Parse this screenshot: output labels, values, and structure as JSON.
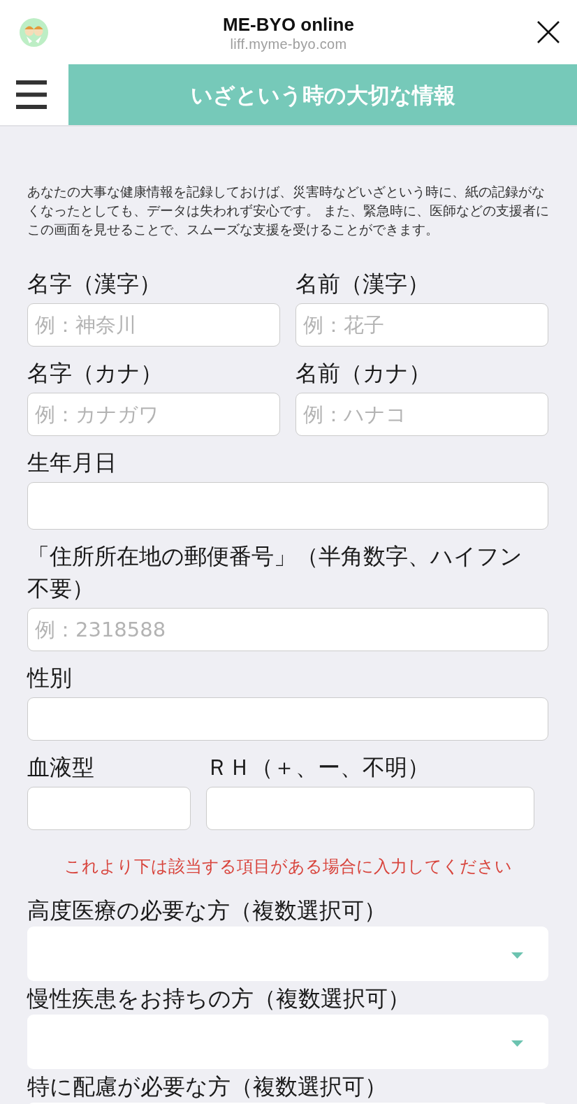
{
  "app_bar": {
    "title": "ME-BYO online",
    "url": "liff.myme-byo.com"
  },
  "page_header": {
    "title": "いざという時の大切な情報"
  },
  "intro": "あなたの大事な健康情報を記録しておけば、災害時などいざという時に、紙の記録がなくなったとしても、データは失われず安心です。 また、緊急時に、医師などの支援者にこの画面を見せることで、スムーズな支援を受けることができます。",
  "form": [
    {
      "kind": "pair",
      "fields": [
        {
          "kind": "text",
          "label": "名字（漢字）",
          "placeholder": "例：神奈川"
        },
        {
          "kind": "text",
          "label": "名前（漢字）",
          "placeholder": "例：花子"
        }
      ]
    },
    {
      "kind": "pair",
      "fields": [
        {
          "kind": "text",
          "label": "名字（カナ）",
          "placeholder": "例：カナガワ"
        },
        {
          "kind": "text",
          "label": "名前（カナ）",
          "placeholder": "例：ハナコ"
        }
      ]
    },
    {
      "kind": "full",
      "fields": [
        {
          "kind": "date",
          "label": "生年月日"
        }
      ]
    },
    {
      "kind": "full",
      "fields": [
        {
          "kind": "text",
          "label": "「住所所在地の郵便番号」（半角数字、ハイフン不要）",
          "placeholder": "例：2318588"
        }
      ]
    },
    {
      "kind": "full",
      "fields": [
        {
          "kind": "text",
          "label": "性別"
        }
      ]
    },
    {
      "kind": "short-long",
      "fields": [
        {
          "kind": "text",
          "label": "血液型"
        },
        {
          "kind": "text",
          "label": "ＲＨ（＋、ー、不明）"
        }
      ]
    },
    {
      "kind": "notice",
      "text": "これより下は該当する項目がある場合に入力してください"
    },
    {
      "kind": "full",
      "fields": [
        {
          "kind": "select",
          "label": "高度医療の必要な方（複数選択可）"
        }
      ]
    },
    {
      "kind": "full",
      "fields": [
        {
          "kind": "select",
          "label": "慢性疾患をお持ちの方（複数選択可）"
        }
      ]
    },
    {
      "kind": "full",
      "fields": [
        {
          "kind": "select",
          "label": "特に配慮が必要な方（複数選択可）"
        }
      ]
    }
  ]
}
